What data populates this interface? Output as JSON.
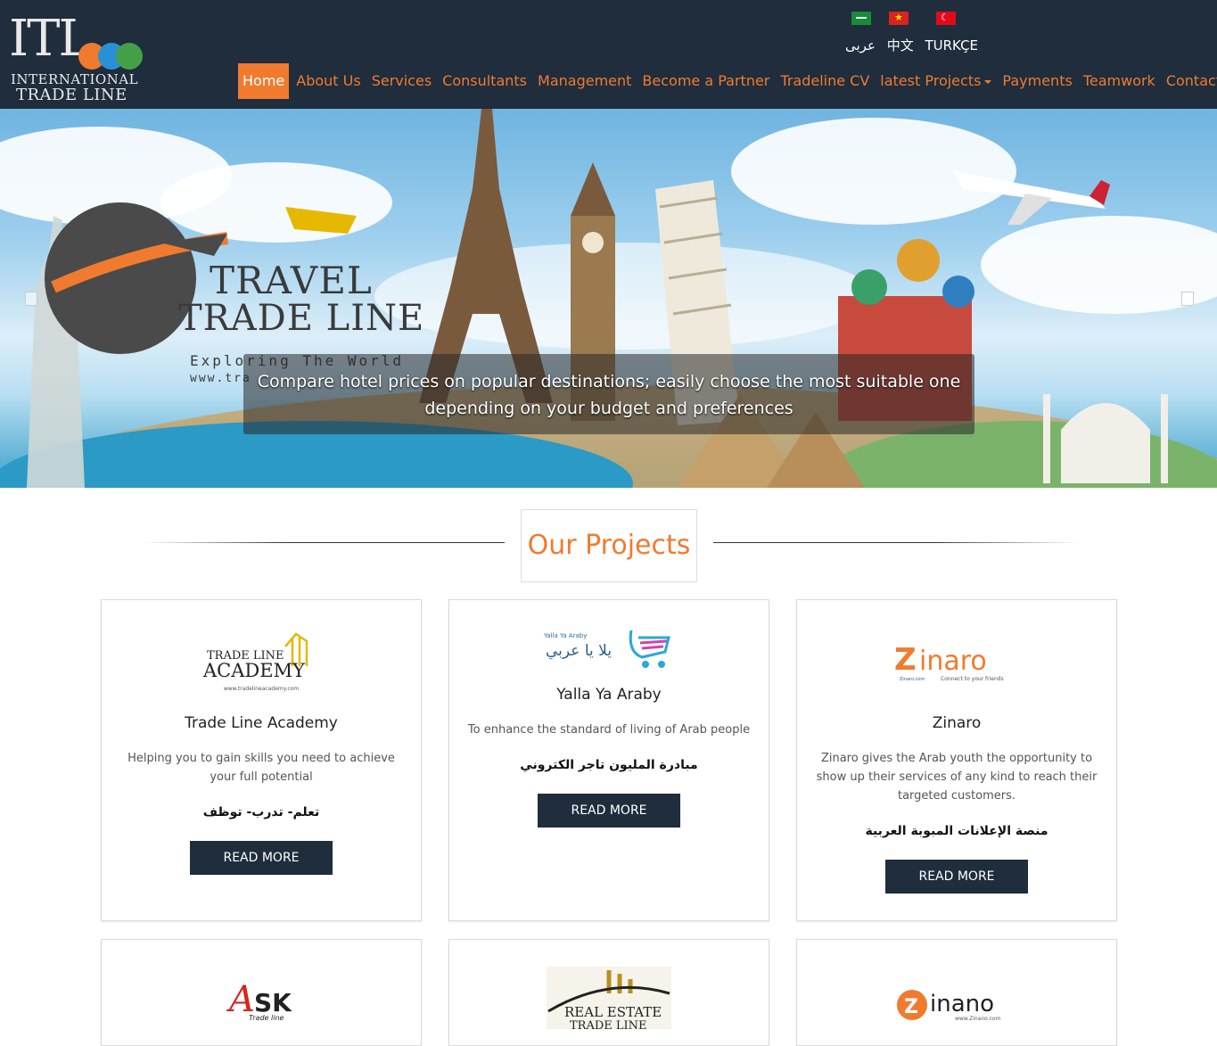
{
  "logo": {
    "mark": "ITL",
    "line1": "INTERNATIONAL",
    "line2": "TRADE LINE"
  },
  "languages": [
    "عربى",
    "中文",
    "TURKÇE"
  ],
  "nav": {
    "items": [
      "Home",
      "About Us",
      "Services",
      "Consultants",
      "Management",
      "Become a Partner",
      "Tradeline CV",
      "latest Projects",
      "Payments",
      "Teamwork",
      "Contact Us"
    ],
    "active": "Home",
    "accent": "#f07b2e"
  },
  "hero": {
    "brand_line1": "TRAVEL",
    "brand_line2": "TRADE LINE",
    "tagline": "Exploring The World",
    "url_fragment": "www.tra",
    "caption": "Compare hotel prices on popular destinations; easily choose the most suitable one depending on your budget and preferences"
  },
  "section": {
    "title": "Our Projects"
  },
  "projects": [
    {
      "logo_text": "TRADE LINE ACADEMY",
      "logo_url": "www.tradelineacademy.com",
      "title": "Trade Line Academy",
      "description": "Helping you to gain skills you need to achieve your full potential",
      "arabic": "تعلم- تدرب- توظف",
      "button": "READ MORE"
    },
    {
      "logo_text": "يلا يا عربي",
      "logo_sub": "Yalla Ya Araby",
      "title": "Yalla Ya Araby",
      "description": "To enhance the standard of living of Arab people",
      "arabic": "مبادرة المليون تاجر الكتروني",
      "button": "READ MORE"
    },
    {
      "logo_text": "Zinaro",
      "logo_sub": "Connect to your friends",
      "logo_url": "Zinaro.com",
      "title": "Zinaro",
      "description": "Zinaro gives the Arab youth the opportunity to show up their services of any kind to reach their targeted customers.",
      "arabic": "منصة الإعلانات المبوبة العربية",
      "button": "READ MORE"
    },
    {
      "logo_text": "ASK",
      "logo_sub": "Trade line"
    },
    {
      "logo_text": "REAL ESTATE",
      "logo_sub": "TRADE LINE"
    },
    {
      "logo_text": "Zinano",
      "logo_url": "www.Zinano.com"
    }
  ],
  "colors": {
    "header_bg": "#1f2d3d",
    "accent": "#f07b2e",
    "button_bg": "#1f2d3d"
  }
}
